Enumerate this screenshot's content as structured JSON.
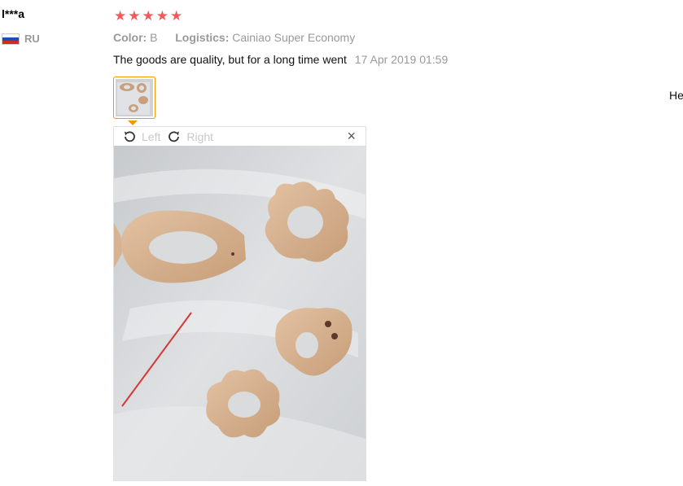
{
  "review": {
    "user_name": "l***a",
    "country_code": "RU",
    "rating_stars": 5,
    "color_label": "Color:",
    "color_value": "B",
    "logistics_label": "Logistics:",
    "logistics_value": "Cainiao Super Economy",
    "text": "The goods are quality, but for a long time went",
    "date": "17 Apr 2019 01:59"
  },
  "side_text": "He",
  "viewer": {
    "rotate_left_label": "Left",
    "rotate_right_label": "Right",
    "close_label": "×"
  },
  "colors": {
    "star": "#f45a5a",
    "thumb_border": "#f39800",
    "muted_text": "#999999"
  }
}
